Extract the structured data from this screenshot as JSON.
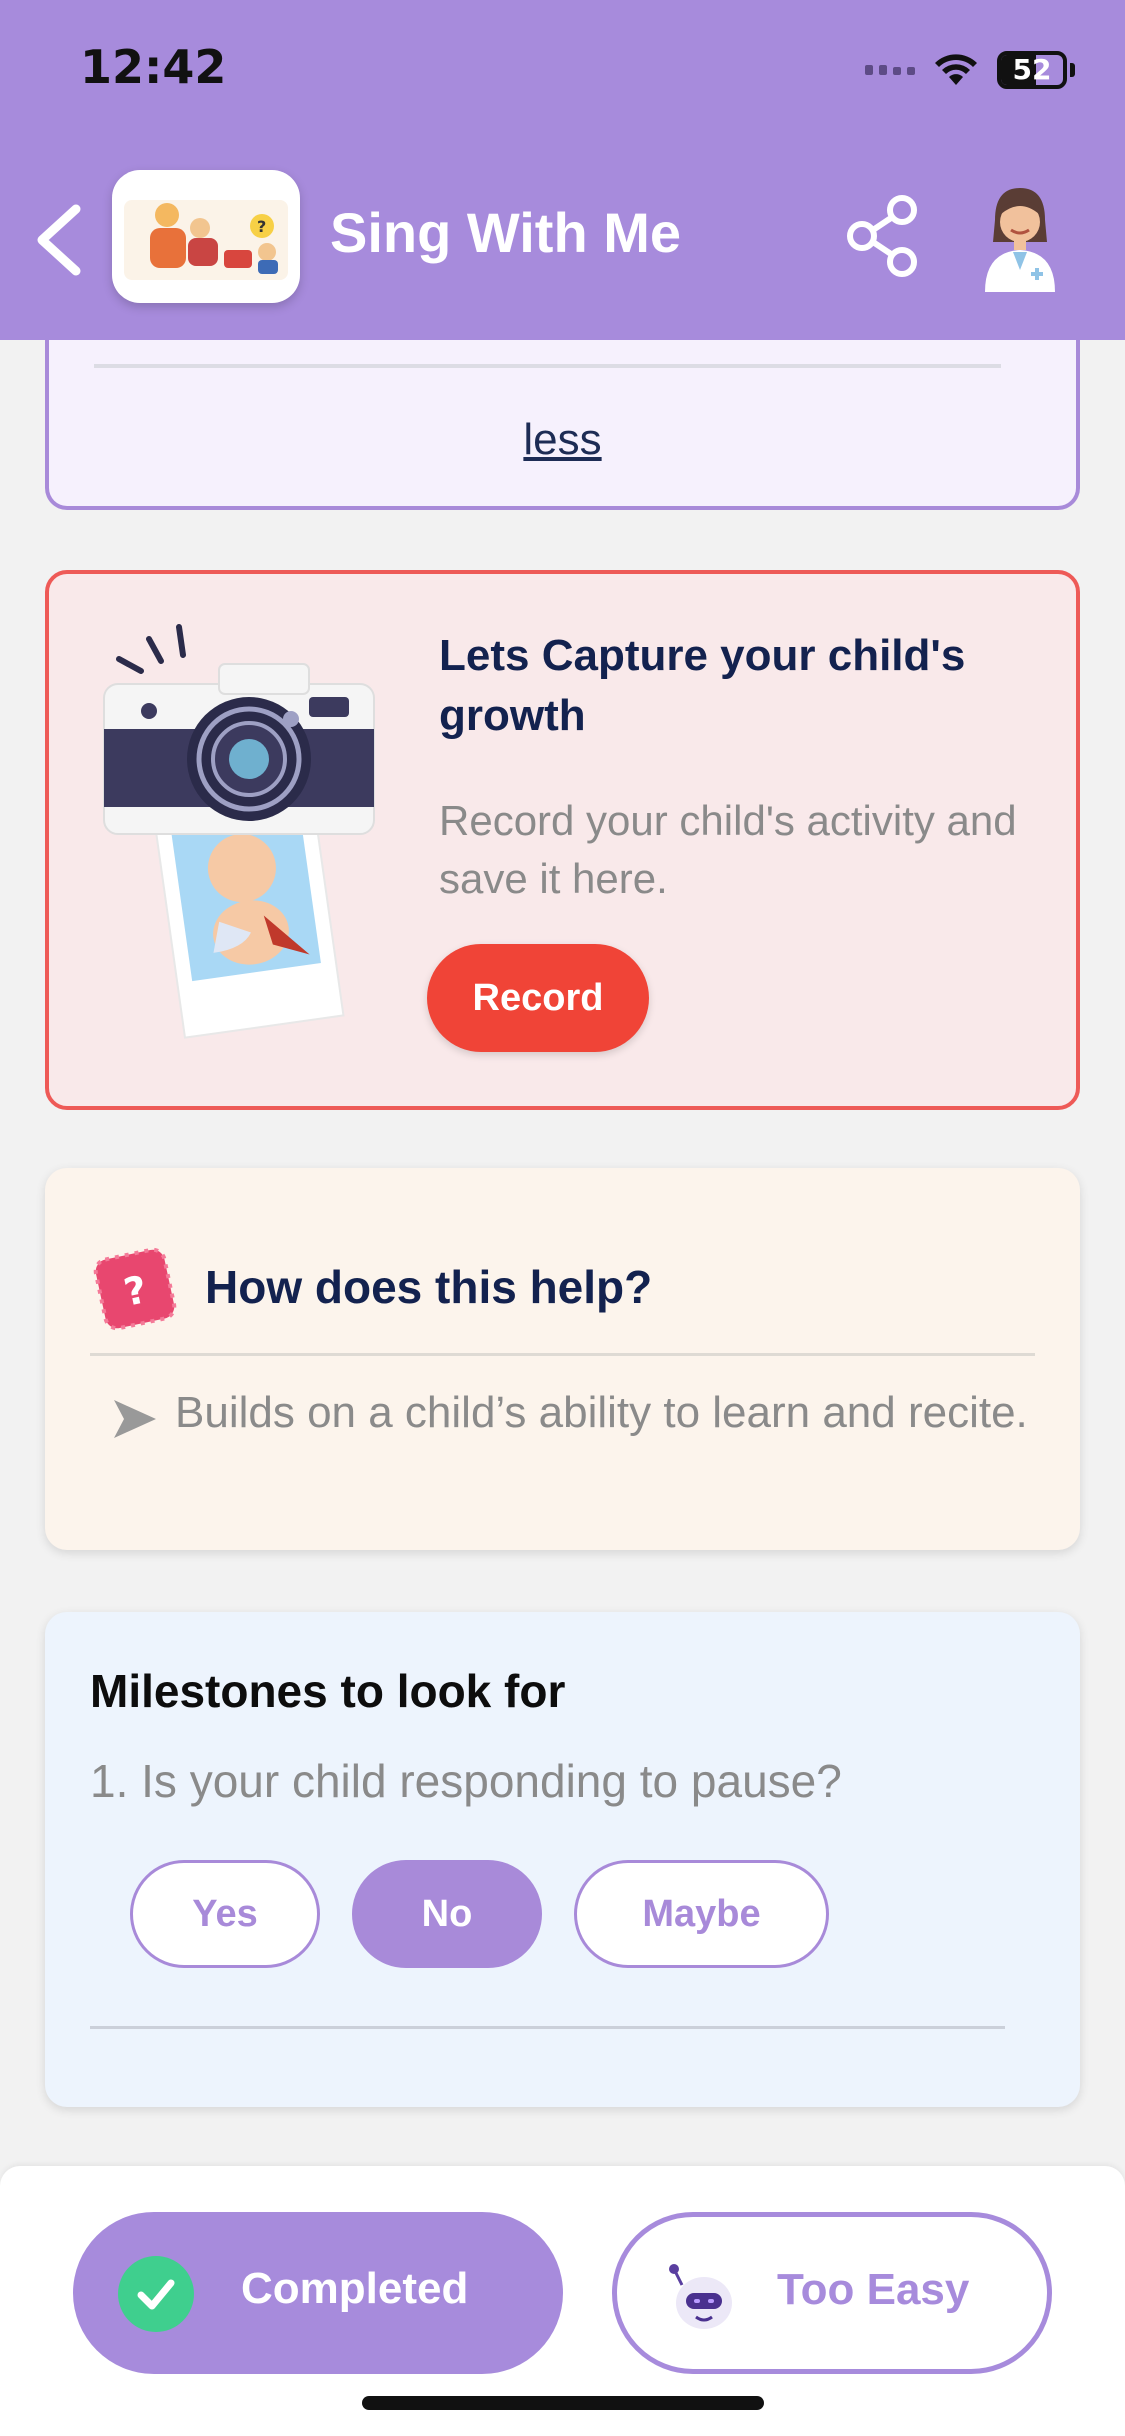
{
  "status_bar": {
    "time": "12:42",
    "battery": "52"
  },
  "header": {
    "title": "Sing With Me"
  },
  "less_card": {
    "link_label": "less"
  },
  "capture_card": {
    "title": "Lets Capture your child's growth",
    "description": "Record your child's activity and save it here.",
    "button_label": "Record"
  },
  "help_card": {
    "title": "How does this help?",
    "points": [
      "Builds on a child’s ability to learn and recite."
    ]
  },
  "milestone_card": {
    "title": "Milestones to look for",
    "question": "1. Is your child responding to pause?",
    "answers": [
      "Yes",
      "No",
      "Maybe"
    ],
    "selected_answer": "No"
  },
  "bottom_bar": {
    "completed_label": "Completed",
    "too_easy_label": "Too Easy"
  },
  "colors": {
    "header_purple": "#a78bdc",
    "record_red": "#f04437",
    "check_green": "#3fcf8e",
    "title_navy": "#13224f"
  }
}
